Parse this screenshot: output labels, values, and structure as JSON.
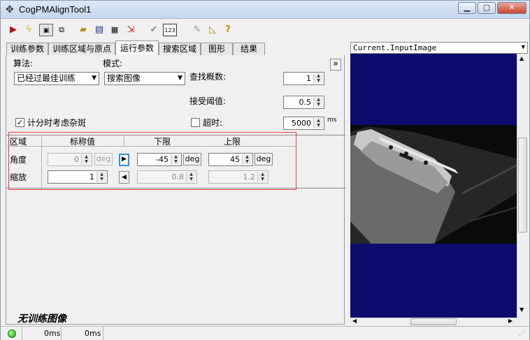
{
  "window": {
    "title": "CogPMAlignTool1"
  },
  "tabs": [
    {
      "label": "训练参数"
    },
    {
      "label": "训练区域与原点"
    },
    {
      "label": "运行参数"
    },
    {
      "label": "搜索区域"
    },
    {
      "label": "图形"
    },
    {
      "label": "结果"
    }
  ],
  "panel": {
    "algorithm_label": "算法:",
    "algorithm_value": "已经过最佳训练",
    "mode_label": "模式:",
    "mode_value": "搜索图像",
    "find_count_label": "查找概数:",
    "find_count_value": "1",
    "accept_label": "接受阈值:",
    "accept_value": "0.5",
    "clutter_label": "计分时考虑杂斑",
    "clutter_checked": "✓",
    "timeout_label": "超时:",
    "timeout_value": "5000",
    "timeout_unit": "ms",
    "expand_glyph": "»"
  },
  "dof_table": {
    "headers": {
      "region": "区域",
      "nominal": "标称值",
      "low": "下限",
      "high": "上限"
    },
    "rows": [
      {
        "name": "角度",
        "nominal": "0",
        "nominal_unit": "deg",
        "toggle": "▶",
        "low": "-45",
        "low_unit": "deg",
        "high": "45",
        "high_unit": "deg"
      },
      {
        "name": "缩放",
        "nominal": "1",
        "toggle": "◀",
        "low": "0.8",
        "high": "1.2"
      }
    ]
  },
  "no_train_image": "无训练图像",
  "viewer": {
    "selector_value": "Current.InputImage"
  },
  "status": {
    "time1": "0ms",
    "time2": "0ms"
  }
}
